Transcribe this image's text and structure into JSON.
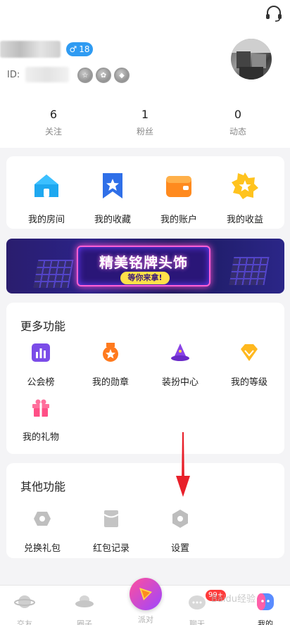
{
  "profile": {
    "gender_symbol": "♂",
    "age": "18",
    "id_label": "ID:"
  },
  "stats": [
    {
      "value": "6",
      "label": "关注"
    },
    {
      "value": "1",
      "label": "粉丝"
    },
    {
      "value": "0",
      "label": "动态"
    }
  ],
  "quick_actions": [
    {
      "label": "我的房间",
      "icon": "home-icon"
    },
    {
      "label": "我的收藏",
      "icon": "bookmark-star-icon"
    },
    {
      "label": "我的账户",
      "icon": "wallet-icon"
    },
    {
      "label": "我的收益",
      "icon": "star-badge-icon"
    }
  ],
  "banner": {
    "title": "精美铭牌头饰",
    "subtitle": "等你来拿!"
  },
  "more_section": {
    "title": "更多功能",
    "items": [
      {
        "label": "公会榜",
        "icon": "bar-chart-icon"
      },
      {
        "label": "我的勋章",
        "icon": "medal-icon"
      },
      {
        "label": "装扮中心",
        "icon": "wizard-hat-icon"
      },
      {
        "label": "我的等级",
        "icon": "diamond-icon"
      },
      {
        "label": "我的礼物",
        "icon": "gift-icon"
      }
    ]
  },
  "other_section": {
    "title": "其他功能",
    "items": [
      {
        "label": "兑换礼包",
        "icon": "redeem-icon"
      },
      {
        "label": "红包记录",
        "icon": "red-envelope-icon"
      },
      {
        "label": "设置",
        "icon": "settings-icon"
      }
    ]
  },
  "tabbar": {
    "items": [
      {
        "label": "交友",
        "icon": "planet-icon"
      },
      {
        "label": "圈子",
        "icon": "ufo-icon"
      },
      {
        "label": "派对",
        "icon": "party-icon"
      },
      {
        "label": "聊天",
        "icon": "chat-icon",
        "badge": "99+"
      },
      {
        "label": "我的",
        "icon": "profile-icon"
      }
    ],
    "active": "我的"
  },
  "watermark": "Baidu经验",
  "colors": {
    "accent_blue": "#2f9bf2",
    "accent_purple": "#9d46ff",
    "arrow_red": "#e8202a"
  }
}
